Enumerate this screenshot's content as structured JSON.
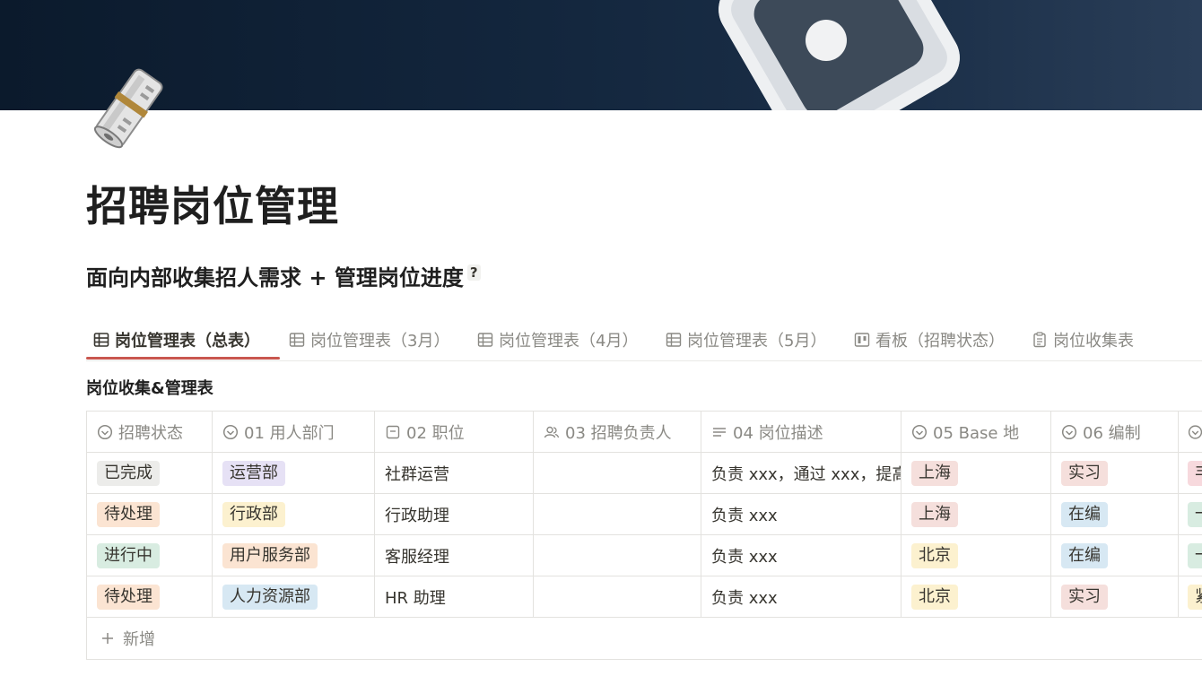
{
  "page": {
    "title": "招聘岗位管理",
    "subtitle": "面向内部收集招人需求 + 管理岗位进度",
    "subtitle_help": "?"
  },
  "tabs": [
    {
      "label": "岗位管理表（总表）",
      "icon": "table-icon",
      "active": true
    },
    {
      "label": "岗位管理表（3月）",
      "icon": "table-icon",
      "active": false
    },
    {
      "label": "岗位管理表（4月）",
      "icon": "table-icon",
      "active": false
    },
    {
      "label": "岗位管理表（5月）",
      "icon": "table-icon",
      "active": false
    },
    {
      "label": "看板（招聘状态）",
      "icon": "board-icon",
      "active": false
    },
    {
      "label": "岗位收集表",
      "icon": "form-icon",
      "active": false
    }
  ],
  "view_title": "岗位收集&管理表",
  "table": {
    "columns": [
      {
        "label": "招聘状态",
        "icon": "status-icon"
      },
      {
        "label": "01 用人部门",
        "icon": "select-icon"
      },
      {
        "label": "02 职位",
        "icon": "title-icon"
      },
      {
        "label": "03 招聘负责人",
        "icon": "person-icon"
      },
      {
        "label": "04 岗位描述",
        "icon": "text-icon"
      },
      {
        "label": "05 Base 地",
        "icon": "select-icon"
      },
      {
        "label": "06 编制",
        "icon": "select-icon"
      },
      {
        "label": "",
        "icon": "select-icon"
      }
    ],
    "rows": [
      {
        "status": "已完成",
        "status_color": "#ececea",
        "dept": "运营部",
        "dept_color": "#e6e1f5",
        "position": "社群运营",
        "owner": "",
        "desc": "负责 xxx，通过 xxx，提高",
        "base": "上海",
        "base_color": "#f5dfdc",
        "type": "实习",
        "type_color": "#f5dfdc",
        "extra": "丰",
        "extra_color": "#f7d9dd"
      },
      {
        "status": "待处理",
        "status_color": "#fbe4d2",
        "dept": "行政部",
        "dept_color": "#fcf1cf",
        "position": "行政助理",
        "owner": "",
        "desc": "负责 xxx",
        "base": "上海",
        "base_color": "#f5dfdc",
        "type": "在编",
        "type_color": "#d7e8f3",
        "extra": "一",
        "extra_color": "#d8ece1"
      },
      {
        "status": "进行中",
        "status_color": "#d8ece1",
        "dept": "用户服务部",
        "dept_color": "#fbe4d2",
        "position": "客服经理",
        "owner": "",
        "desc": "负责 xxx",
        "base": "北京",
        "base_color": "#fcf1cf",
        "type": "在编",
        "type_color": "#d7e8f3",
        "extra": "一",
        "extra_color": "#d8ece1"
      },
      {
        "status": "待处理",
        "status_color": "#fbe4d2",
        "dept": "人力资源部",
        "dept_color": "#d7e8f3",
        "position": "HR 助理",
        "owner": "",
        "desc": "负责 xxx",
        "base": "北京",
        "base_color": "#fcf1cf",
        "type": "实习",
        "type_color": "#f5dfdc",
        "extra": "紧",
        "extra_color": "#fcf1cf"
      }
    ],
    "add_label": "新增"
  }
}
